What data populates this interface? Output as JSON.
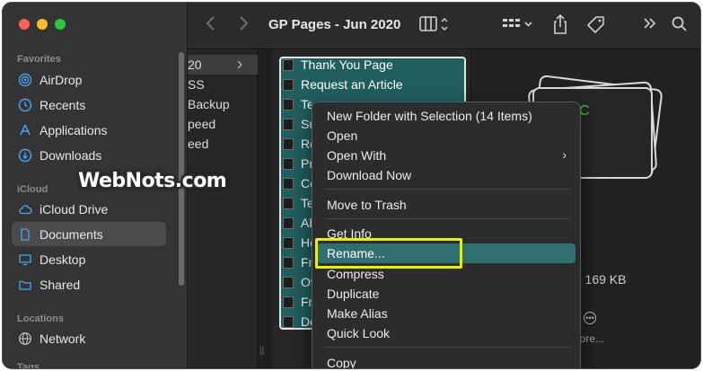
{
  "window": {
    "title": "GP Pages - Jun 2020"
  },
  "sidebar": {
    "sections": [
      {
        "heading": "Favorites"
      },
      {
        "heading": "iCloud"
      },
      {
        "heading": "Locations"
      },
      {
        "heading": "Tags"
      }
    ],
    "favorites": [
      {
        "label": "AirDrop",
        "icon": "airdrop-icon"
      },
      {
        "label": "Recents",
        "icon": "clock-icon"
      },
      {
        "label": "Applications",
        "icon": "applications-icon"
      },
      {
        "label": "Downloads",
        "icon": "download-icon"
      }
    ],
    "icloud": [
      {
        "label": "iCloud Drive",
        "icon": "cloud-icon"
      },
      {
        "label": "Documents",
        "icon": "document-icon",
        "selected": true
      },
      {
        "label": "Desktop",
        "icon": "desktop-icon"
      },
      {
        "label": "Shared",
        "icon": "shared-folder-icon"
      }
    ],
    "locations": [
      {
        "label": "Network",
        "icon": "network-icon"
      }
    ]
  },
  "column1": {
    "rows": [
      {
        "text": "20",
        "selected": true
      },
      {
        "text": "SS"
      },
      {
        "text": "Backup"
      },
      {
        "text": "peed"
      },
      {
        "text": "eed"
      }
    ]
  },
  "files": [
    "Thank You Page",
    "Request an Article",
    "Te",
    "Su",
    "Re",
    "Pr",
    "Co",
    "Te",
    "Ab",
    "He",
    "Fr",
    "Ov",
    "Fr",
    "Do"
  ],
  "preview": {
    "thumb_letter": "C",
    "size_text": "- 169 KB",
    "more_label": "lore..."
  },
  "context_menu": {
    "items": [
      {
        "label": "New Folder with Selection (14 Items)"
      },
      {
        "label": "Open"
      },
      {
        "label": "Open With",
        "submenu": true
      },
      {
        "label": "Download Now"
      },
      {
        "label": "Move to Trash"
      },
      {
        "label": "Get Info"
      },
      {
        "label": "Rename...",
        "highlighted": true
      },
      {
        "label": "Compress"
      },
      {
        "label": "Duplicate"
      },
      {
        "label": "Make Alias"
      },
      {
        "label": "Quick Look"
      },
      {
        "label": "Copy"
      }
    ],
    "submenu_arrow": "›"
  },
  "watermark": "WebNots.com",
  "colors": {
    "selection": "#215e5e",
    "menu_highlight": "#2f6f6f",
    "callout": "#e8f000"
  }
}
